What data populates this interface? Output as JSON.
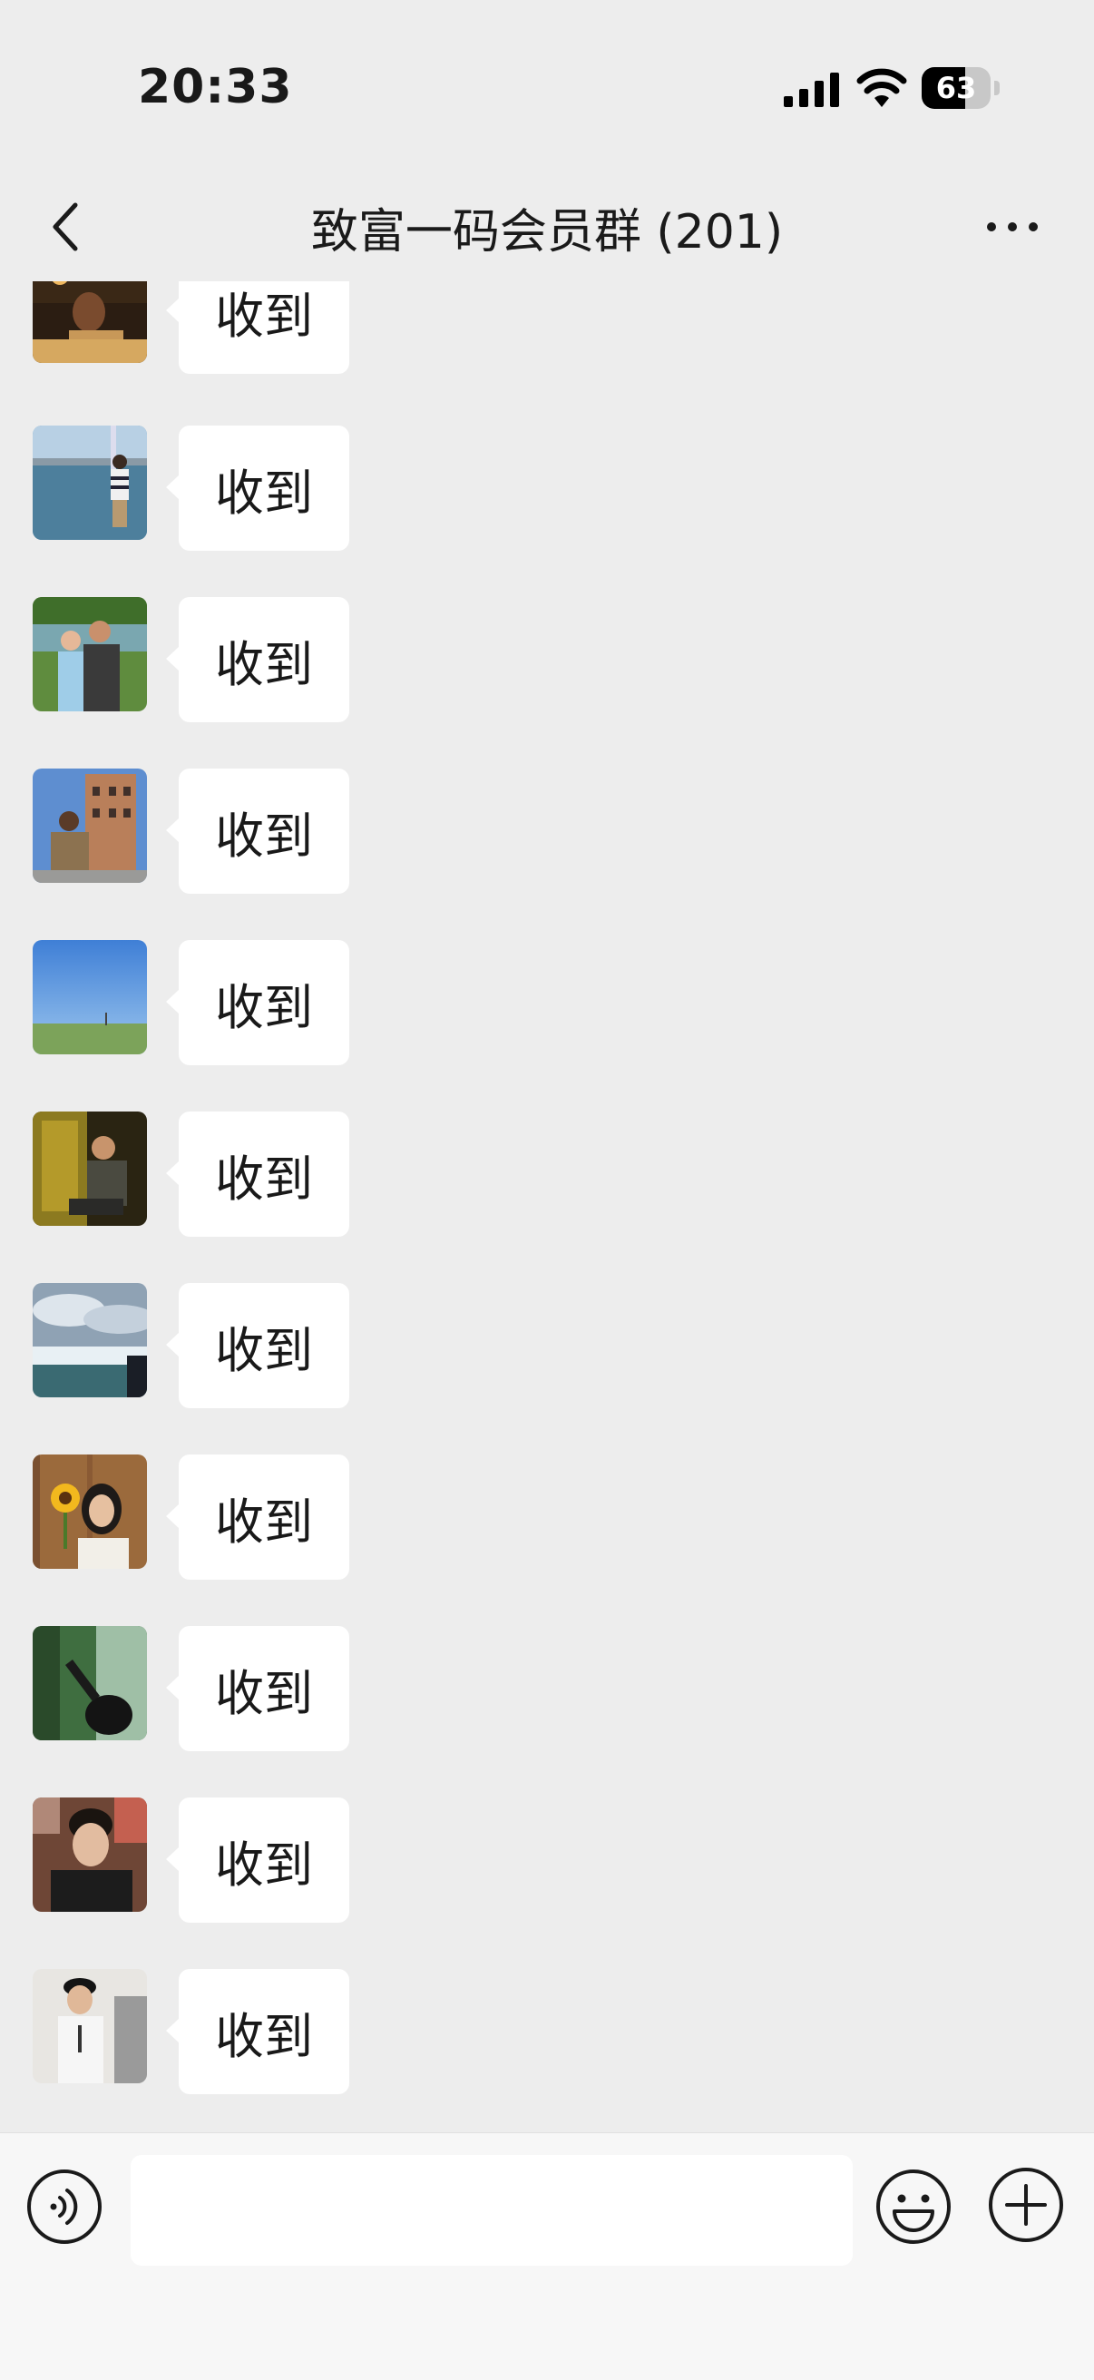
{
  "status_bar": {
    "time": "20:33",
    "battery": "63",
    "battery_level": 0.63
  },
  "nav": {
    "title": "致富一码会员群 (201)"
  },
  "messages": [
    {
      "text": "收到",
      "avatar": "night-dinner-photo"
    },
    {
      "text": "收到",
      "avatar": "man-at-harbor-photo"
    },
    {
      "text": "收到",
      "avatar": "couple-by-lake-photo"
    },
    {
      "text": "收到",
      "avatar": "man-at-building-photo"
    },
    {
      "text": "收到",
      "avatar": "blue-sky-field-photo"
    },
    {
      "text": "收到",
      "avatar": "man-sitting-photo"
    },
    {
      "text": "收到",
      "avatar": "waterfall-clouds-photo"
    },
    {
      "text": "收到",
      "avatar": "girl-with-sunflower-photo"
    },
    {
      "text": "收到",
      "avatar": "woman-in-forest-photo"
    },
    {
      "text": "收到",
      "avatar": "young-man-photo"
    },
    {
      "text": "收到",
      "avatar": "man-with-cap-photo"
    }
  ],
  "input": {
    "value": "",
    "placeholder": ""
  },
  "icons": {
    "back": "chevron-left-icon",
    "more": "more-dots-icon",
    "voice": "voice-icon",
    "emoji": "emoji-icon",
    "plus": "plus-icon"
  }
}
